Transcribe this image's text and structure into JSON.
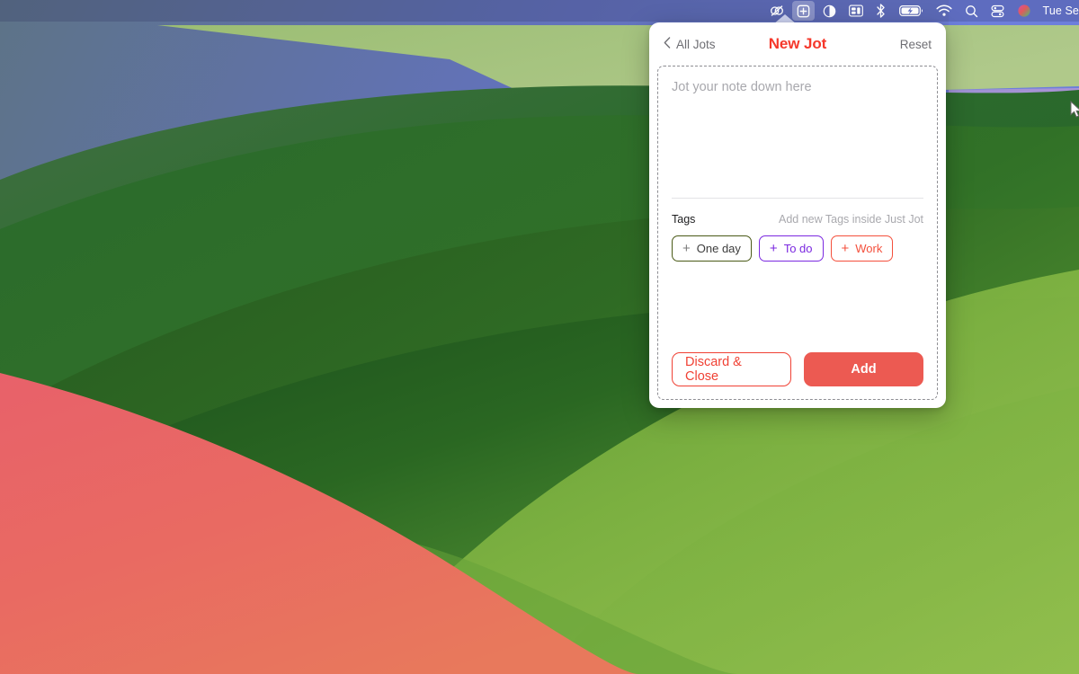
{
  "desktop": {
    "wallpaper_colors": {
      "sky_blue": "#6f80dd",
      "sky_slate": "#5a7086",
      "purple_light": "#c091dd",
      "purple_mid": "#a98fce",
      "green_dark": "#1d5a23",
      "green_mid": "#3f8530",
      "green_light": "#8cbb4a",
      "green_pale": "#a9c873",
      "coral": "#ea6064",
      "coral_warm": "#e9705d"
    }
  },
  "menubar": {
    "background": "#5d6bc4",
    "items": [
      {
        "name": "adobe-creative-cloud-icon",
        "glyph": "cc",
        "active": false
      },
      {
        "name": "just-jot-plus-icon",
        "glyph": "plus-box",
        "active": true
      },
      {
        "name": "display-contrast-icon",
        "glyph": "half-circle",
        "active": false
      },
      {
        "name": "window-manager-icon",
        "glyph": "grid",
        "active": false
      },
      {
        "name": "bluetooth-icon",
        "glyph": "bluetooth",
        "active": false
      },
      {
        "name": "battery-charging-icon",
        "glyph": "battery",
        "active": false
      },
      {
        "name": "wifi-icon",
        "glyph": "wifi",
        "active": false
      },
      {
        "name": "spotlight-search-icon",
        "glyph": "magnifier",
        "active": false
      },
      {
        "name": "control-center-icon",
        "glyph": "control-center",
        "active": false
      },
      {
        "name": "siri-icon",
        "glyph": "siri",
        "active": false
      }
    ],
    "clock": "Tue Se"
  },
  "popover": {
    "header": {
      "back_label": "All Jots",
      "title": "New Jot",
      "title_color": "#f5382b",
      "reset_label": "Reset"
    },
    "note": {
      "placeholder": "Jot your note down here",
      "value": ""
    },
    "tags": {
      "label": "Tags",
      "hint": "Add new Tags inside Just Jot",
      "items": [
        {
          "label": "One day",
          "color": "#4a5a17",
          "text_color": "#3d3d3d",
          "plus_color": "#7b7b7b"
        },
        {
          "label": "To do",
          "color": "#7b29e0",
          "text_color": "#7b29e0",
          "plus_color": "#7b29e0"
        },
        {
          "label": "Work",
          "color": "#f4503c",
          "text_color": "#f4503c",
          "plus_color": "#f4503c"
        }
      ]
    },
    "actions": {
      "discard_label": "Discard & Close",
      "add_label": "Add",
      "discard_color": "#f04134",
      "add_bg": "#ec5a52"
    }
  }
}
